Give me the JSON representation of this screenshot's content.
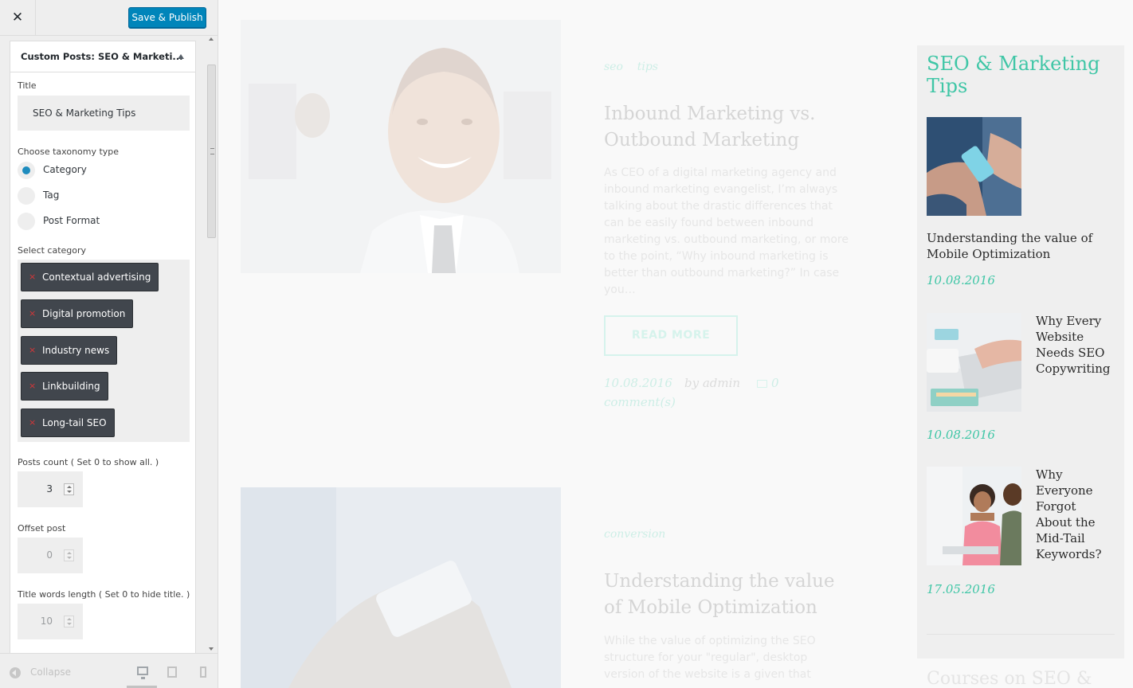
{
  "header": {
    "close_glyph": "✕",
    "save_label": "Save & Publish"
  },
  "panel": {
    "title_prefix": "Custom Posts: ",
    "title_name": "SEO & Marketi...",
    "title_field_label": "Title",
    "title_field_value": "SEO & Marketing Tips",
    "taxonomy_label": "Choose taxonomy type",
    "taxonomy_options": [
      {
        "label": "Category",
        "checked": true
      },
      {
        "label": "Tag",
        "checked": false
      },
      {
        "label": "Post Format",
        "checked": false
      }
    ],
    "category_label": "Select category",
    "categories": [
      "Contextual advertising",
      "Digital promotion",
      "Industry news",
      "Linkbuilding",
      "Long-tail SEO"
    ],
    "chip_remove_glyph": "×",
    "posts_count_label": "Posts count ( Set 0 to show all. )",
    "posts_count_value": "3",
    "offset_label": "Offset post",
    "offset_value": "0",
    "title_words_label": "Title words length ( Set 0 to hide title. )",
    "title_words_value": "10"
  },
  "footer": {
    "collapse_label": "Collapse",
    "devices": [
      "desktop-icon",
      "tablet-icon",
      "mobile-icon"
    ]
  },
  "preview": {
    "post1": {
      "tags": [
        "seo",
        "tips"
      ],
      "title": "Inbound Marketing vs. Outbound Marketing",
      "excerpt": "As CEO of a digital marketing agency and inbound marketing evangelist, I’m always talking about the drastic differences that can be easily found between inbound marketing vs. outbound marketing, or more to the point, “Why inbound marketing is better than outbound marketing?” In case you…",
      "read_more": "READ MORE",
      "date": "10.08.2016",
      "author": "by admin",
      "comments": "0",
      "comments_suffix": "comment(s)"
    },
    "post2": {
      "tag": "conversion",
      "title": "Understanding the value of Mobile Optimization",
      "excerpt": "While the value of optimizing the SEO structure for your \"regular\", desktop version of the website is a given that"
    },
    "widget": {
      "title": "SEO & Marketing Tips",
      "posts": [
        {
          "title": "Understanding the value of Mobile Optimization",
          "date": "10.08.2016"
        },
        {
          "title": "Why Every Website Needs SEO Copywriting",
          "date": "10.08.2016"
        },
        {
          "title": "Why Everyone Forgot About the Mid-Tail Keywords?",
          "date": "17.05.2016"
        }
      ],
      "next_title": "Courses on SEO &"
    },
    "colors": {
      "accent": "#3fc6a6",
      "publish": "#0085ba"
    }
  }
}
